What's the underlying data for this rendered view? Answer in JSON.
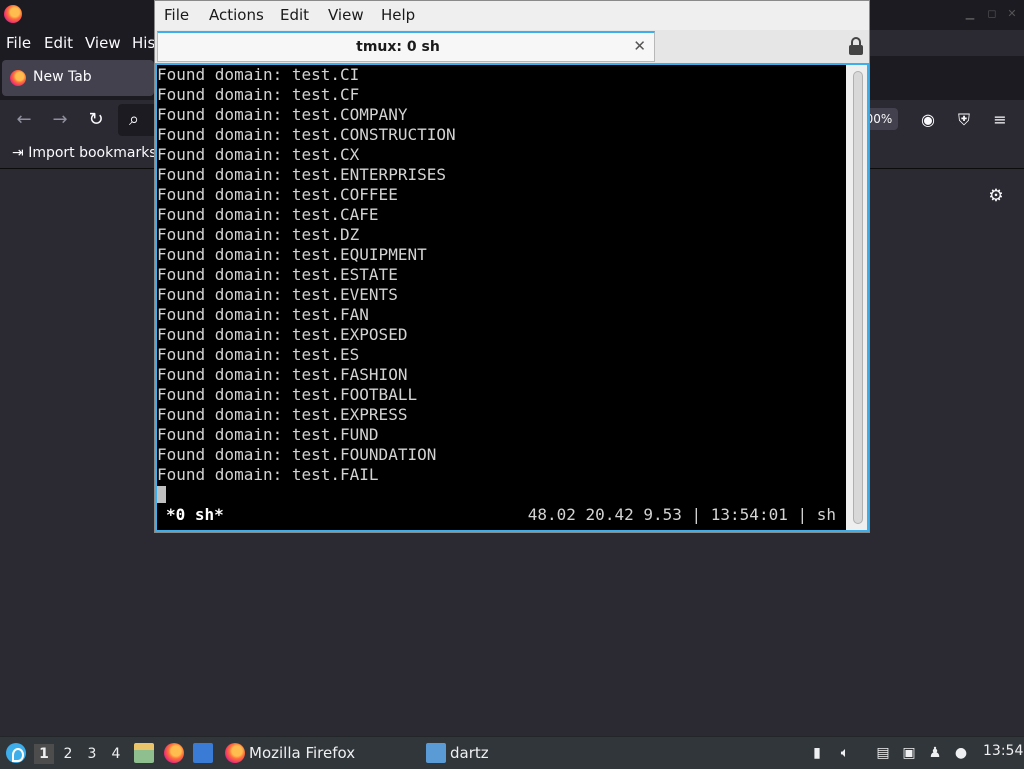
{
  "firefox": {
    "menu": [
      "File",
      "Edit",
      "View",
      "His"
    ],
    "tab_label": "New Tab",
    "zoom": "00%",
    "bookmark": "Import bookmarks..."
  },
  "terminal": {
    "menu": [
      "File",
      "Actions",
      "Edit",
      "View",
      "Help"
    ],
    "tab_title": "tmux: 0 sh",
    "lines": [
      "Found domain: test.CI",
      "Found domain: test.CF",
      "Found domain: test.COMPANY",
      "Found domain: test.CONSTRUCTION",
      "Found domain: test.CX",
      "Found domain: test.ENTERPRISES",
      "Found domain: test.COFFEE",
      "Found domain: test.CAFE",
      "Found domain: test.DZ",
      "Found domain: test.EQUIPMENT",
      "Found domain: test.ESTATE",
      "Found domain: test.EVENTS",
      "Found domain: test.FAN",
      "Found domain: test.EXPOSED",
      "Found domain: test.ES",
      "Found domain: test.FASHION",
      "Found domain: test.FOOTBALL",
      "Found domain: test.EXPRESS",
      "Found domain: test.FUND",
      "Found domain: test.FOUNDATION",
      "Found domain: test.FAIL"
    ],
    "status_left": "*0 sh*",
    "status_right": "48.02 20.42 9.53 | 13:54:01 | sh"
  },
  "taskbar": {
    "workspaces": [
      "1",
      "2",
      "3",
      "4"
    ],
    "active_workspace": "1",
    "tasks": [
      {
        "label": "Mozilla Firefox",
        "icon": "firefox-icon"
      },
      {
        "label": "dartz",
        "icon": "folder-icon"
      }
    ],
    "clock": "13:54"
  }
}
